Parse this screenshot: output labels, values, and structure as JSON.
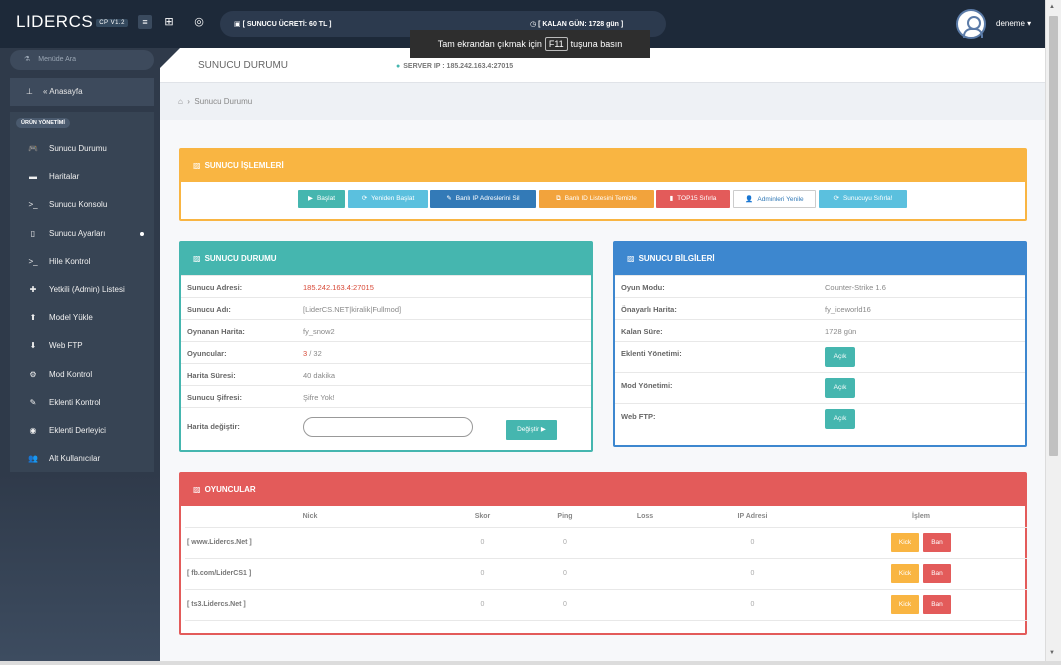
{
  "colors": {
    "topbar": "#1d2939",
    "sidebar": "#2f3a4a",
    "yellow": "#f9b542",
    "teal": "#45b6af",
    "blue": "#3d87cf",
    "red": "#e35b5a",
    "orange": "#f2a33c",
    "sky": "#5bc0de",
    "primary": "#337ab7"
  },
  "topbar": {
    "brand": "LIDERCS",
    "version": "CP V1.2",
    "fee": "[ SUNUCU ÜCRETİ: 60 TL ]",
    "days_left": "[ KALAN GÜN: 1728 gün ]",
    "fullscreen_tip_pre": "Tam ekrandan çıkmak için",
    "fullscreen_key": "F11",
    "fullscreen_tip_post": "tuşuna basın",
    "username": "deneme"
  },
  "sidebar": {
    "search": "Menüde Ara",
    "home": "« Anasayfa",
    "section": "ÜRÜN YÖNETİMİ",
    "items": [
      {
        "label": "Sunucu Durumu",
        "icon": "gamepad-icon",
        "glyph": "🎮"
      },
      {
        "label": "Haritalar",
        "icon": "briefcase-icon",
        "glyph": "▬"
      },
      {
        "label": "Sunucu Konsolu",
        "icon": "terminal-icon",
        "glyph": ">_"
      },
      {
        "label": "Sunucu Ayarları",
        "icon": "file-icon",
        "glyph": "▯"
      },
      {
        "label": "Hile Kontrol",
        "icon": "terminal-icon",
        "glyph": ">_"
      },
      {
        "label": "Yetkili (Admin) Listesi",
        "icon": "user-add-icon",
        "glyph": "✚"
      },
      {
        "label": "Model Yükle",
        "icon": "upload-icon",
        "glyph": "⬆"
      },
      {
        "label": "Web FTP",
        "icon": "download-icon",
        "glyph": "⬇"
      },
      {
        "label": "Mod Kontrol",
        "icon": "gear-icon",
        "glyph": "⚙"
      },
      {
        "label": "Eklenti Kontrol",
        "icon": "wrench-icon",
        "glyph": "✎"
      },
      {
        "label": "Eklenti Derleyici",
        "icon": "eye-icon",
        "glyph": "◉"
      },
      {
        "label": "Alt Kullanıcılar",
        "icon": "users-icon",
        "glyph": "👥"
      }
    ]
  },
  "header": {
    "title": "SUNUCU DURUMU",
    "server_ip": "SERVER IP : 185.242.163.4:27015"
  },
  "breadcrumb": {
    "current": "Sunucu Durumu"
  },
  "operations": {
    "title": "SUNUCU İŞLEMLERİ",
    "buttons": [
      {
        "label": "Başlat",
        "glyph": "▶"
      },
      {
        "label": "Yeniden Başlat",
        "glyph": "⟳"
      },
      {
        "label": "Banlı IP Adreslerini Sil",
        "glyph": "✎"
      },
      {
        "label": "Banlı ID Listesini Temizle",
        "glyph": "⧉"
      },
      {
        "label": "TOP15 Sıfırla",
        "glyph": "▮"
      },
      {
        "label": "Adminleri Yenile",
        "glyph": "👤"
      },
      {
        "label": "Sunucuyu Sıfırla!",
        "glyph": "⟳"
      }
    ]
  },
  "status": {
    "title": "SUNUCU DURUMU",
    "address_label": "Sunucu Adresi:",
    "address": "185.242.163.4:27015",
    "name_label": "Sunucu Adı:",
    "name": "[LiderCS.NET|kiralik|Fullmod]",
    "map_label": "Oynanan Harita:",
    "map": "fy_snow2",
    "players_label": "Oyuncular:",
    "players_current": "3",
    "players_max": " / 32",
    "duration_label": "Harita Süresi:",
    "duration": "40 dakika",
    "password_label": "Sunucu Şifresi:",
    "password": "Şifre Yok!",
    "change_label": "Harita değiştir:",
    "change_value": "",
    "change_button": "Değiştir ▶"
  },
  "info": {
    "title": "SUNUCU BİLGİLERİ",
    "mode_label": "Oyun Modu:",
    "mode": "Counter-Strike 1.6",
    "default_map_label": "Önayarlı Harita:",
    "default_map": "fy_iceworld16",
    "remaining_label": "Kalan Süre:",
    "remaining": "1728 gün",
    "plugin_label": "Eklenti Yönetimi:",
    "mod_label": "Mod Yönetimi:",
    "ftp_label": "Web FTP:",
    "open": "Açık"
  },
  "players": {
    "title": "OYUNCULAR",
    "columns": [
      "Nick",
      "Skor",
      "Ping",
      "Loss",
      "IP Adresi",
      "İşlem"
    ],
    "rows": [
      {
        "nick": "[ www.Lidercs.Net ]",
        "score": "0",
        "ping": "0",
        "loss": "",
        "ip": "0"
      },
      {
        "nick": "[ fb.com/LiderCS1 ]",
        "score": "0",
        "ping": "0",
        "loss": "",
        "ip": "0"
      },
      {
        "nick": "[ ts3.Lidercs.Net ]",
        "score": "0",
        "ping": "0",
        "loss": "",
        "ip": "0"
      }
    ],
    "kick": "Kick",
    "ban": "Ban"
  }
}
